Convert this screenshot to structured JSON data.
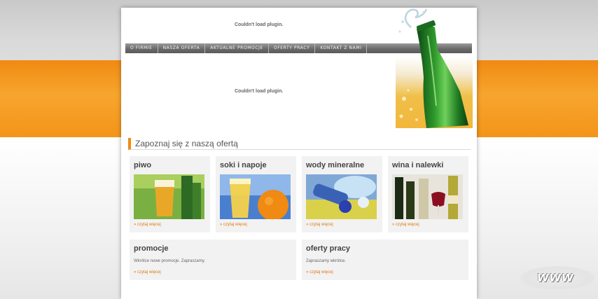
{
  "header": {
    "plugin_message_top": "Couldn't load plugin.",
    "plugin_message_main": "Couldn't load plugin."
  },
  "nav": {
    "items": [
      {
        "label": "O FIRMIE"
      },
      {
        "label": "NASZA OFERTA"
      },
      {
        "label": "AKTUALNE PROMOCJE"
      },
      {
        "label": "OFERTY PRACY"
      },
      {
        "label": "KONTAKT Z NAMI"
      }
    ]
  },
  "section": {
    "title": "Zapoznaj się z naszą ofertą"
  },
  "products": [
    {
      "title": "piwo",
      "link": "» czytaj więcej",
      "icon": "beer-glass-image"
    },
    {
      "title": "soki i napoje",
      "link": "» czytaj więcej",
      "icon": "juice-orange-image"
    },
    {
      "title": "wody mineralne",
      "link": "» czytaj więcej",
      "icon": "water-bottles-image"
    },
    {
      "title": "wina i nalewki",
      "link": "» czytaj więcej",
      "icon": "wine-bottles-image"
    }
  ],
  "promos": {
    "title": "promocje",
    "text": "Wkrótce nowe promocje. Zapraszamy.",
    "link": "» czytaj więcej"
  },
  "jobs": {
    "title": "oferty pracy",
    "text": "Zapraszamy wkrótce.",
    "link": "» czytaj więcej"
  },
  "badge": {
    "label": "WWW"
  },
  "colors": {
    "accent": "#f08a12",
    "link": "#e07a10",
    "nav": "#6a6a6a"
  }
}
